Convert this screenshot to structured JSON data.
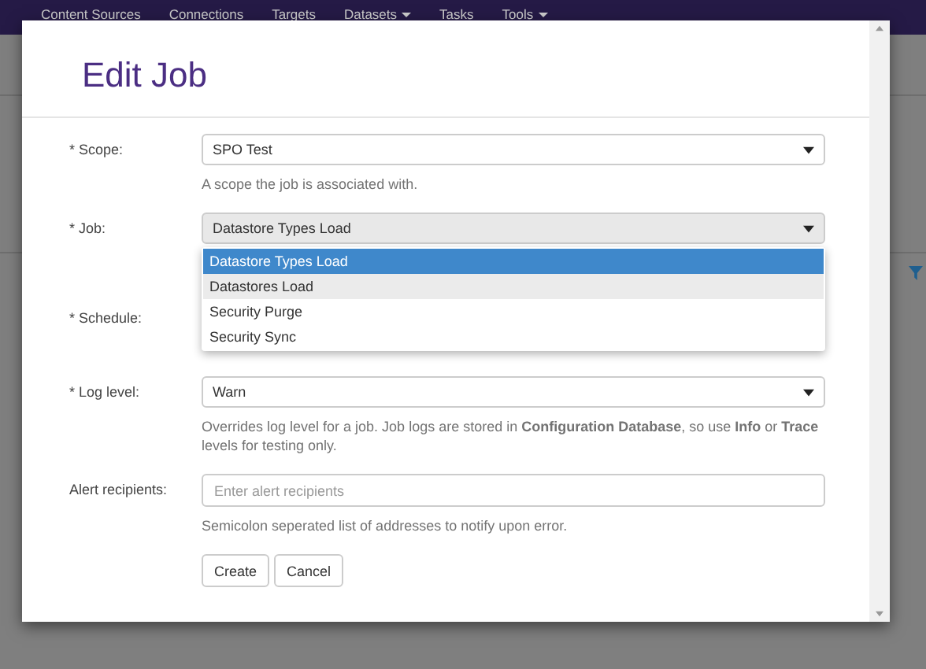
{
  "navbar": {
    "items": [
      {
        "label": "Content Sources",
        "has_caret": false
      },
      {
        "label": "Connections",
        "has_caret": false
      },
      {
        "label": "Targets",
        "has_caret": false
      },
      {
        "label": "Datasets",
        "has_caret": true
      },
      {
        "label": "Tasks",
        "has_caret": false
      },
      {
        "label": "Tools",
        "has_caret": true
      }
    ]
  },
  "modal": {
    "title": "Edit Job",
    "fields": [
      {
        "kind": "select",
        "label": "* Scope:",
        "value": "SPO Test",
        "help": "A scope the job is associated with.",
        "open": false
      },
      {
        "kind": "select",
        "label": "* Job:",
        "value": "Datastore Types Load",
        "open": true,
        "options": [
          {
            "label": "Datastore Types Load",
            "selected": true,
            "hovered": false
          },
          {
            "label": "Datastores Load",
            "selected": false,
            "hovered": true
          },
          {
            "label": "Security Purge",
            "selected": false,
            "hovered": false
          },
          {
            "label": "Security Sync",
            "selected": false,
            "hovered": false
          }
        ]
      },
      {
        "kind": "hidden",
        "label": "* Schedule:"
      },
      {
        "kind": "select",
        "label": "* Log level:",
        "value": "Warn",
        "help": "Overrides log level for a job. Job logs are stored in **Configuration Database**, so use **Info** or **Trace** levels for testing only.",
        "open": false
      },
      {
        "kind": "text",
        "label": "Alert recipients:",
        "placeholder": "Enter alert recipients",
        "help": "Semicolon seperated list of addresses to notify upon error."
      }
    ],
    "buttons": [
      "Create",
      "Cancel"
    ]
  }
}
